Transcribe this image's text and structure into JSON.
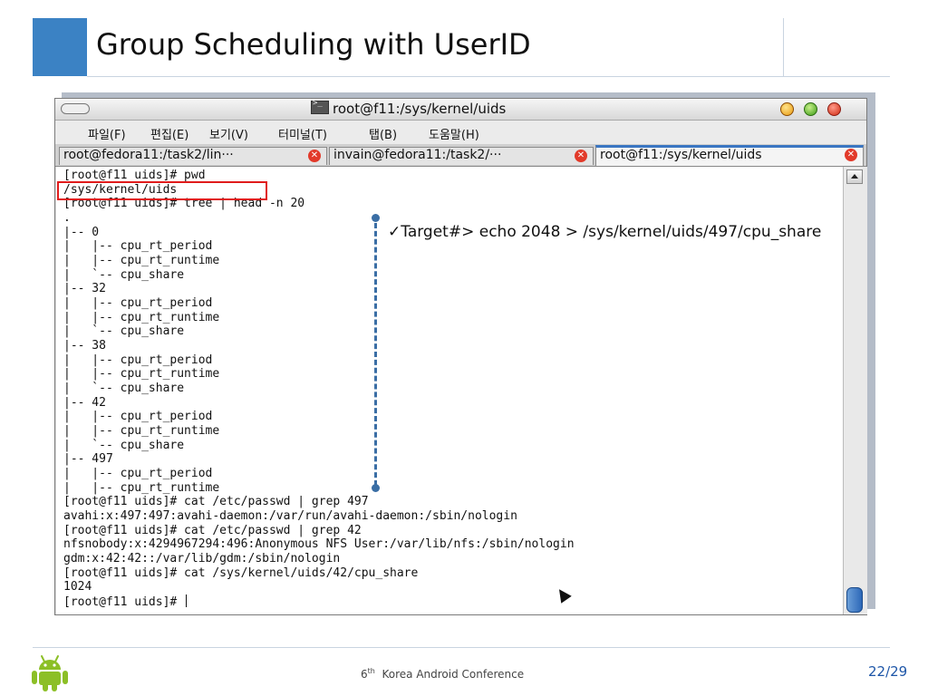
{
  "slide": {
    "title": "Group Scheduling with UserID",
    "footer": {
      "ordinal": "6",
      "ordinal_suffix": "th",
      "event": "Korea Android Conference"
    },
    "page_number": "22/29",
    "accent_color": "#3b82c4"
  },
  "window": {
    "title": "root@f11:/sys/kernel/uids",
    "menu": [
      "파일(F)",
      "편집(E)",
      "보기(V)",
      "터미널(T)",
      "탭(B)",
      "도움말(H)"
    ],
    "tabs": [
      {
        "label": "root@fedora11:/task2/lin···",
        "active": false
      },
      {
        "label": "invain@fedora11:/task2/···",
        "active": false
      },
      {
        "label": "root@f11:/sys/kernel/uids",
        "active": true
      }
    ]
  },
  "terminal": {
    "lines": [
      "[root@f11 uids]# pwd",
      "/sys/kernel/uids",
      "[root@f11 uids]# tree | head -n 20",
      ".",
      "|-- 0",
      "|   |-- cpu_rt_period",
      "|   |-- cpu_rt_runtime",
      "|   `-- cpu_share",
      "|-- 32",
      "|   |-- cpu_rt_period",
      "|   |-- cpu_rt_runtime",
      "|   `-- cpu_share",
      "|-- 38",
      "|   |-- cpu_rt_period",
      "|   |-- cpu_rt_runtime",
      "|   `-- cpu_share",
      "|-- 42",
      "|   |-- cpu_rt_period",
      "|   |-- cpu_rt_runtime",
      "|   `-- cpu_share",
      "|-- 497",
      "|   |-- cpu_rt_period",
      "|   |-- cpu_rt_runtime",
      "[root@f11 uids]# cat /etc/passwd | grep 497",
      "avahi:x:497:497:avahi-daemon:/var/run/avahi-daemon:/sbin/nologin",
      "[root@f11 uids]# cat /etc/passwd | grep 42",
      "nfsnobody:x:4294967294:496:Anonymous NFS User:/var/lib/nfs:/sbin/nologin",
      "gdm:x:42:42::/var/lib/gdm:/sbin/nologin",
      "[root@f11 uids]# cat /sys/kernel/uids/42/cpu_share",
      "1024",
      "[root@f11 uids]# "
    ]
  },
  "annotation": {
    "check_mark": "✓",
    "text": "Target#> echo 2048 > /sys/kernel/uids/497/cpu_share",
    "highlight_color": "#e01b1b",
    "connector_color": "#3a6ea5"
  }
}
